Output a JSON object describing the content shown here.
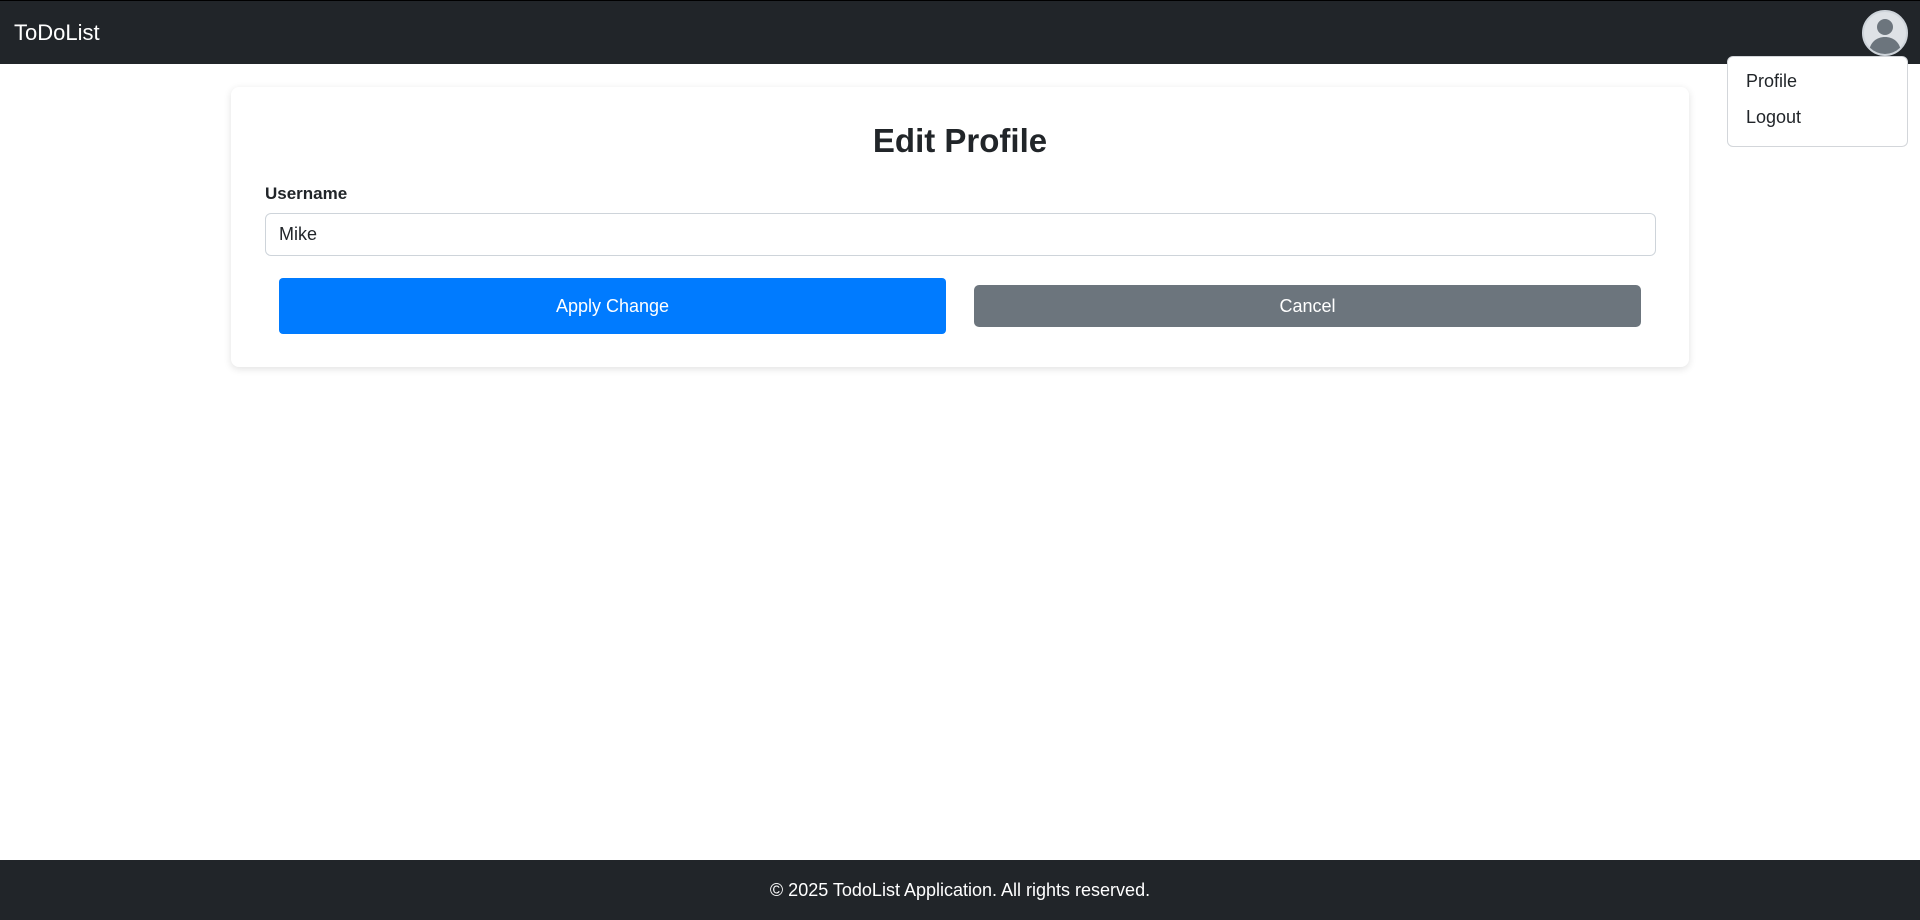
{
  "navbar": {
    "brand": "ToDoList",
    "avatar_icon": "user-avatar-icon"
  },
  "dropdown": {
    "items": [
      {
        "label": "Profile"
      },
      {
        "label": "Logout"
      }
    ]
  },
  "form": {
    "title": "Edit Profile",
    "username_label": "Username",
    "username_value": "Mike",
    "apply_label": "Apply Change",
    "cancel_label": "Cancel"
  },
  "footer": {
    "text": "© 2025 TodoList Application. All rights reserved."
  },
  "colors": {
    "navbar_bg": "#212529",
    "primary": "#007bff",
    "secondary": "#6c757d"
  }
}
